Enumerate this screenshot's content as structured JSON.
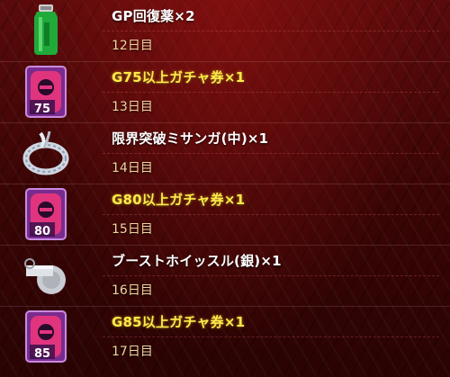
{
  "rewards": [
    {
      "name": "GP回復薬×2",
      "day": "12日目",
      "icon": "green-bottle-icon"
    },
    {
      "name": "G75以上ガチャ券×1",
      "day": "13日目",
      "icon": "gacha-ticket-icon",
      "grade": "75"
    },
    {
      "name": "限界突破ミサンガ(中)×1",
      "day": "14日目",
      "icon": "misanga-bracelet-icon"
    },
    {
      "name": "G80以上ガチャ券×1",
      "day": "15日目",
      "icon": "gacha-ticket-icon",
      "grade": "80"
    },
    {
      "name": "ブーストホイッスル(銀)×1",
      "day": "16日目",
      "icon": "silver-whistle-icon"
    },
    {
      "name": "G85以上ガチャ券×1",
      "day": "17日目",
      "icon": "gacha-ticket-icon",
      "grade": "85"
    }
  ],
  "colors": {
    "ticket_name": "#ffe94a",
    "item_name": "#ffffff",
    "day_text": "#f0d6a0",
    "ticket_pink": "#e0357e",
    "ticket_frame": "#b06ad0"
  }
}
